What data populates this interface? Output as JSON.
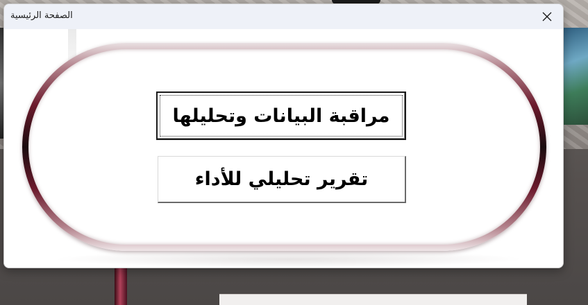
{
  "window": {
    "title": "الصفحة الرئيسية",
    "close_icon": "close-icon"
  },
  "buttons": {
    "data_monitoring": "مراقبة البيانات وتحليلها",
    "performance_report": "تقرير تحليلي للأداء"
  },
  "colors": {
    "frame_dark": "#1a0b0e",
    "frame_maroon": "#6b1a2c",
    "titlebar_bg": "#eef1f8"
  }
}
